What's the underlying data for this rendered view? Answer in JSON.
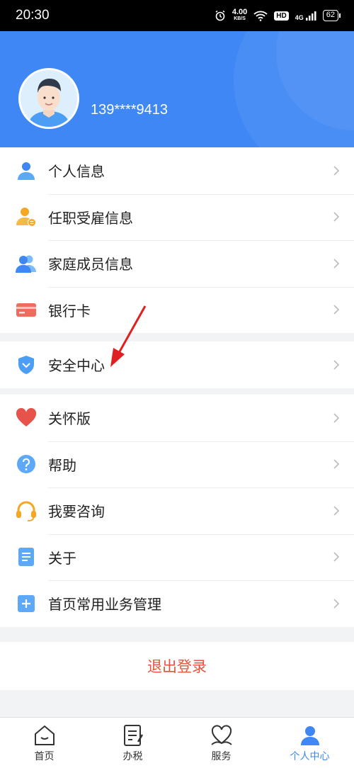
{
  "status_bar": {
    "time": "20:30",
    "speed_value": "4.00",
    "speed_unit": "KB/S",
    "hd": "HD",
    "network": "4G",
    "battery": "62"
  },
  "profile": {
    "phone": "139****9413"
  },
  "menu_group_1": [
    {
      "label": "个人信息",
      "icon": "person-icon"
    },
    {
      "label": "任职受雇信息",
      "icon": "employment-icon"
    },
    {
      "label": "家庭成员信息",
      "icon": "family-icon"
    },
    {
      "label": "银行卡",
      "icon": "bank-card-icon"
    }
  ],
  "menu_group_2": [
    {
      "label": "安全中心",
      "icon": "shield-icon"
    }
  ],
  "menu_group_3": [
    {
      "label": "关怀版",
      "icon": "heart-icon"
    },
    {
      "label": "帮助",
      "icon": "help-icon"
    },
    {
      "label": "我要咨询",
      "icon": "headset-icon"
    },
    {
      "label": "关于",
      "icon": "document-icon"
    },
    {
      "label": "首页常用业务管理",
      "icon": "plus-icon"
    }
  ],
  "logout_label": "退出登录",
  "tabbar": [
    {
      "label": "首页",
      "icon": "home-icon"
    },
    {
      "label": "办税",
      "icon": "tax-icon"
    },
    {
      "label": "服务",
      "icon": "service-icon"
    },
    {
      "label": "个人中心",
      "icon": "profile-icon",
      "active": true
    }
  ],
  "colors": {
    "primary": "#3e87f5",
    "logout": "#e5533d",
    "annotation": "#e02020"
  }
}
